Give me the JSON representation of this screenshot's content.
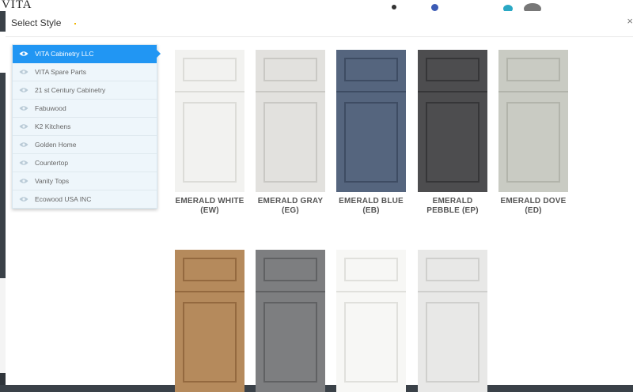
{
  "background": {
    "logo_text": "VITA"
  },
  "modal": {
    "title": "Select Style",
    "close": "×"
  },
  "style_list": [
    {
      "label": "VITA Cabinetry LLC",
      "active": true
    },
    {
      "label": "VITA Spare Parts",
      "active": false
    },
    {
      "label": "21 st Century Cabinetry",
      "active": false
    },
    {
      "label": "Fabuwood",
      "active": false
    },
    {
      "label": "K2 Kitchens",
      "active": false
    },
    {
      "label": "Golden Home",
      "active": false
    },
    {
      "label": "Countertop",
      "active": false
    },
    {
      "label": "Vanity Tops",
      "active": false
    },
    {
      "label": "Ecowood USA INC",
      "active": false
    }
  ],
  "doors": [
    {
      "line1": "EMERALD WHITE",
      "line2": "(EW)",
      "color": "#f2f2f0",
      "shade": "#dcdcd8"
    },
    {
      "line1": "EMERALD GRAY",
      "line2": "(EG)",
      "color": "#e2e1de",
      "shade": "#c9c8c4"
    },
    {
      "line1": "EMERALD BLUE",
      "line2": "(EB)",
      "color": "#55657e",
      "shade": "#3e4c63"
    },
    {
      "line1": "EMERALD",
      "line2": "PEBBLE (EP)",
      "color": "#4d4d4f",
      "shade": "#363638"
    },
    {
      "line1": "EMERALD DOVE",
      "line2": "(ED)",
      "color": "#c9cbc3",
      "shade": "#b2b4ab"
    },
    {
      "line1": "",
      "line2": "",
      "color": "#b58a5c",
      "shade": "#94693f"
    },
    {
      "line1": "",
      "line2": "",
      "color": "#7d7e80",
      "shade": "#606163"
    },
    {
      "line1": "",
      "line2": "",
      "color": "#f7f7f5",
      "shade": "#e0e0dc"
    },
    {
      "line1": "",
      "line2": "",
      "color": "#e8e8e7",
      "shade": "#cfcfcd"
    }
  ]
}
